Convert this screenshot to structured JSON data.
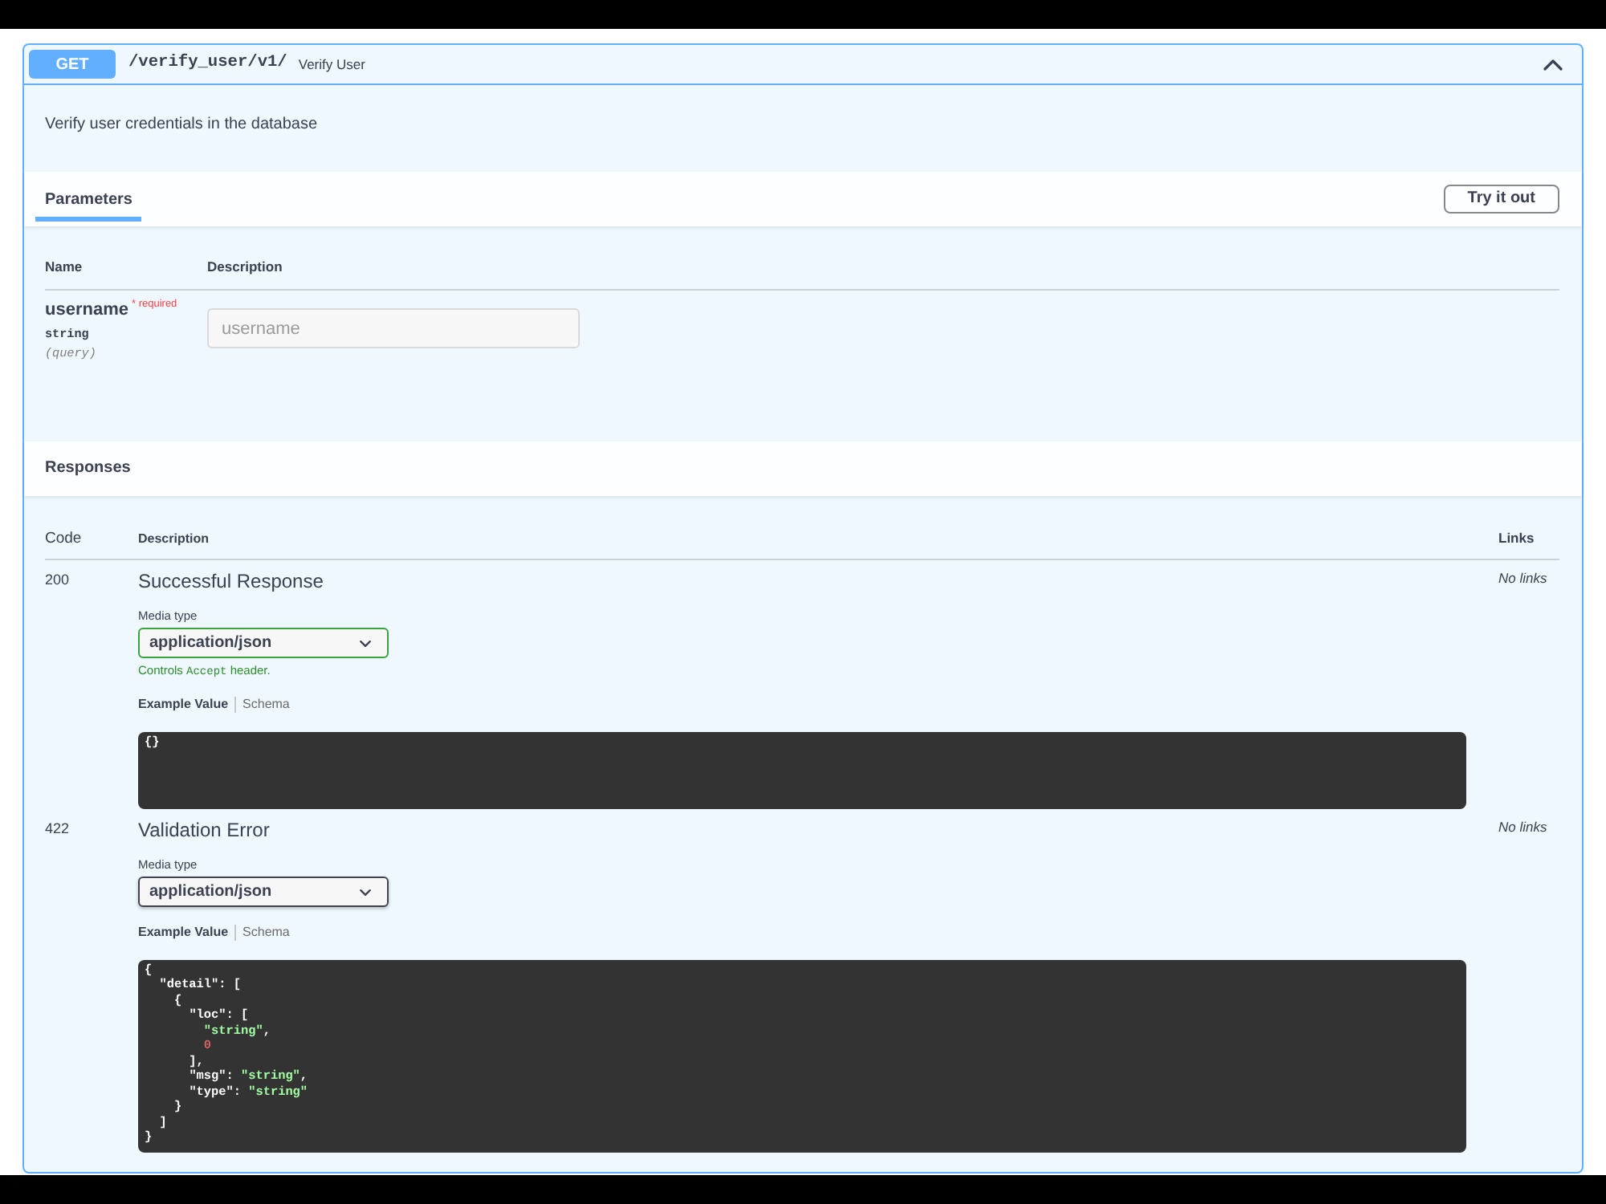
{
  "operation": {
    "method": "GET",
    "path": "/verify_user/v1/",
    "summary": "Verify User",
    "expanded": true,
    "description": "Verify user credentials in the database",
    "parameters": {
      "tabs": [
        {
          "label": "Parameters",
          "selected": true
        }
      ],
      "try_it_out_button": "Try it out",
      "columns": [
        "Name",
        "Description"
      ],
      "rows": [
        {
          "name": "username",
          "required_label": "* required",
          "type": "string",
          "location": "(query)",
          "placeholder": "username"
        }
      ]
    },
    "responses": {
      "title": "Responses",
      "columns": [
        "Code",
        "Description",
        "Links"
      ],
      "rows": [
        {
          "code": "200",
          "description": "Successful Response",
          "media_type_label": "Media type",
          "media_type": "application/json",
          "controls_note": {
            "before": "Controls",
            "code": "Accept",
            "after": "header."
          },
          "example_tabs": [
            {
              "label": "Example Value",
              "selected": true
            },
            {
              "label": "Schema",
              "selected": false
            }
          ],
          "example": "{}",
          "links": "No links"
        },
        {
          "code": "422",
          "description": "Validation Error",
          "media_type_label": "Media type",
          "media_type": "application/json",
          "example_tabs": [
            {
              "label": "Example Value",
              "selected": true
            },
            {
              "label": "Schema",
              "selected": false
            }
          ],
          "example": "{\n  \"detail\": [\n    {\n      \"loc\": [\n        \"string\",\n        0\n      ],\n      \"msg\": \"string\",\n      \"type\": \"string\"\n    }\n  ]\n}",
          "links": "No links"
        }
      ]
    }
  }
}
